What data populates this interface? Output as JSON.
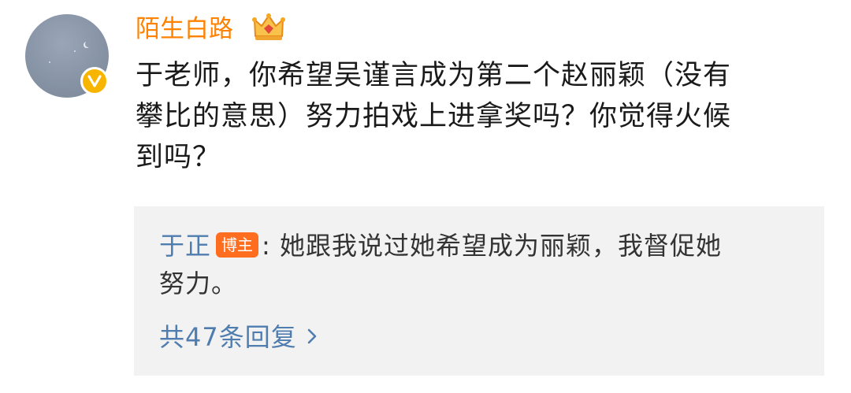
{
  "comment": {
    "username": "陌生白路",
    "text_lines": [
      "于老师，你希望吴谨言成为第二个赵丽颖（没有",
      "攀比的意思）努力拍戏上进拿奖吗？你觉得火候",
      "到吗？"
    ]
  },
  "reply": {
    "author": "于正",
    "author_tag": "博主",
    "separator": ":",
    "text_lines": [
      " 她跟我说过她希望成为丽颖，我督促她",
      "努力。"
    ],
    "more_replies": "共47条回复"
  },
  "colors": {
    "username": "#ff8200",
    "link_blue": "#507daf",
    "verified_badge": "#f7b500",
    "blogger_tag": "#ff6d1f",
    "reply_bg": "#f2f2f2"
  },
  "icons": [
    "verified-badge-icon",
    "crown-vip-icon",
    "chevron-right-icon"
  ]
}
